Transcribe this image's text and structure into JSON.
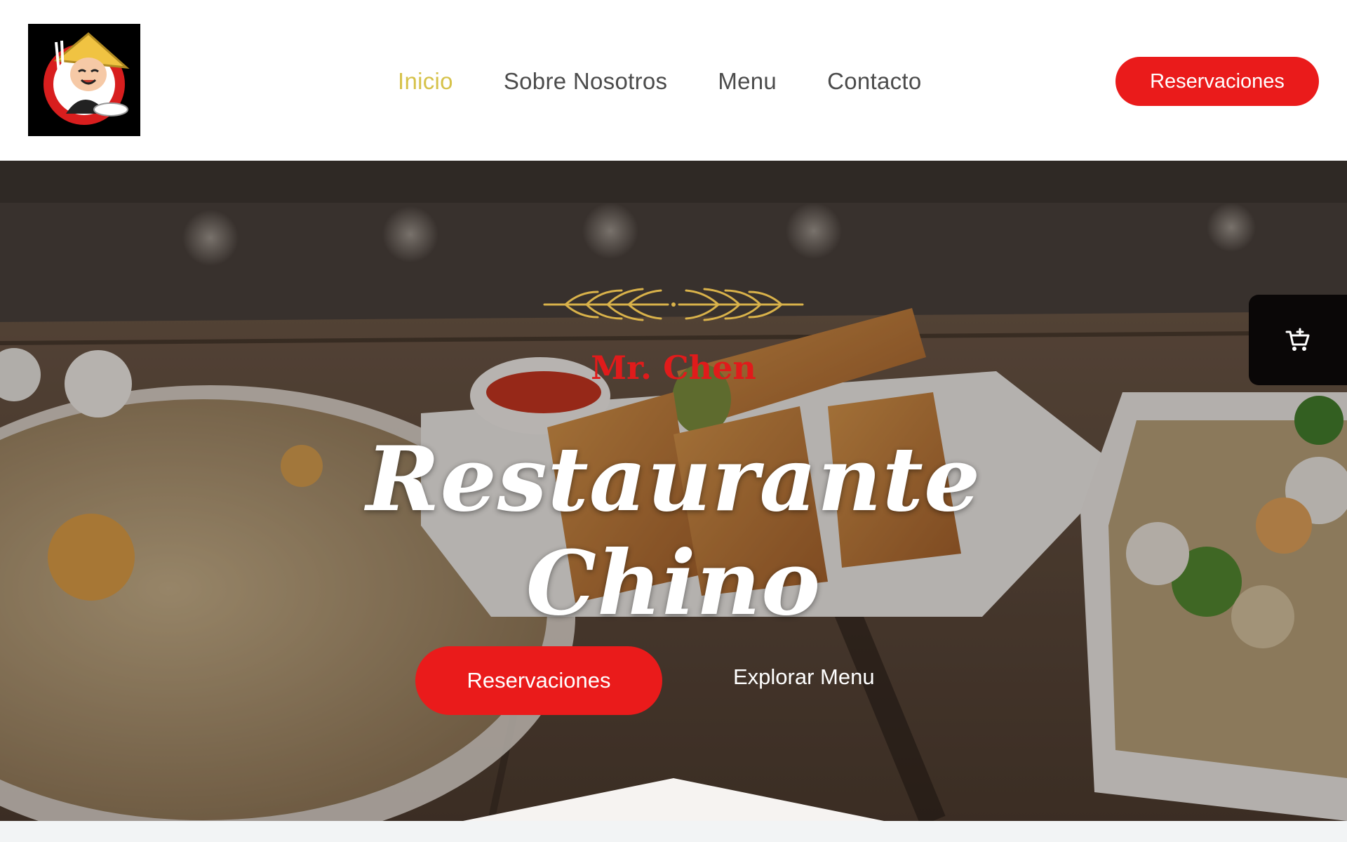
{
  "brand": {
    "logo_icon": "chef-mascot-icon"
  },
  "nav": {
    "items": [
      {
        "label": "Inicio",
        "active": true
      },
      {
        "label": "Sobre Nosotros",
        "active": false
      },
      {
        "label": "Menu",
        "active": false
      },
      {
        "label": "Contacto",
        "active": false
      }
    ]
  },
  "header": {
    "cta_label": "Reservaciones"
  },
  "hero": {
    "subtitle": "Mr. Chen",
    "title": "Restaurante Chino",
    "primary_cta": "Reservaciones",
    "secondary_cta": "Explorar Menu",
    "ornament_icon": "wheat-ornament-icon",
    "cart_icon": "add-to-cart-icon"
  },
  "colors": {
    "accent_red": "#ea1b1b",
    "active_nav": "#d6c24a",
    "nav_text": "#4b4b4b",
    "ornament_gold": "#d9b24a"
  }
}
